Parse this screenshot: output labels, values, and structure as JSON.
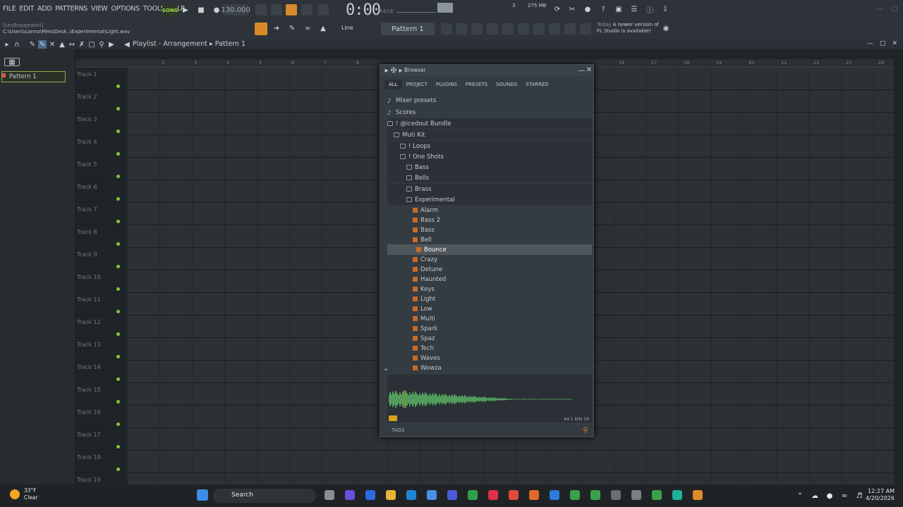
{
  "menu": [
    "FILE",
    "EDIT",
    "ADD",
    "PATTERNS",
    "VIEW",
    "OPTIONS",
    "TOOLS",
    "HELP"
  ],
  "hint_user": "[LeoBogajewski]",
  "hint_path": "C:\\Users\\canno\\Files\\Desk..\\Experimental\\Light.wav",
  "transport": {
    "song_label": "SONG",
    "tempo": "130.000",
    "time": "0:00",
    "time_sub": "M:S:CS",
    "pattern": "Pattern 1",
    "snap": "Line",
    "mem": "275 MB",
    "cpu": "3"
  },
  "news": {
    "day": "Today",
    "text1": "A newer version of",
    "text2": "FL Studio is available!"
  },
  "playlist": {
    "title": "Playlist - Arrangement",
    "pattern": "Pattern 1",
    "pattern_item": "Pattern 1"
  },
  "tracks": [
    "Track 1",
    "Track 2",
    "Track 3",
    "Track 4",
    "Track 5",
    "Track 6",
    "Track 7",
    "Track 8",
    "Track 9",
    "Track 10",
    "Track 11",
    "Track 12",
    "Track 13",
    "Track 14",
    "Track 15",
    "Track 16",
    "Track 17",
    "Track 18",
    "Track 19"
  ],
  "ruler": [
    "2",
    "3",
    "4",
    "5",
    "6",
    "7",
    "8",
    "16",
    "17",
    "18",
    "19",
    "20",
    "21",
    "22",
    "23",
    "24"
  ],
  "browser": {
    "title": "Browser",
    "tabs": [
      "ALL",
      "PROJECT",
      "PLUGINS",
      "PRESETS",
      "SOUNDS",
      "STARRED"
    ],
    "items": [
      {
        "label": "Mixer presets",
        "indent": 0,
        "type": "special"
      },
      {
        "label": "Scores",
        "indent": 0,
        "type": "special"
      },
      {
        "label": "! @icedout Bundle",
        "indent": 0,
        "type": "folder",
        "dark": true
      },
      {
        "label": "Muti Kit",
        "indent": 1,
        "type": "folder",
        "dark": true
      },
      {
        "label": "! Loops",
        "indent": 2,
        "type": "folder",
        "dark": true
      },
      {
        "label": "! One Shots",
        "indent": 2,
        "type": "folder",
        "dark": true
      },
      {
        "label": "Bass",
        "indent": 3,
        "type": "folder",
        "dark": true
      },
      {
        "label": "Bells",
        "indent": 3,
        "type": "folder",
        "dark": true
      },
      {
        "label": "Brass",
        "indent": 3,
        "type": "folder",
        "dark": true
      },
      {
        "label": "Experimental",
        "indent": 3,
        "type": "folder",
        "dark": true
      },
      {
        "label": "Alarm",
        "indent": 4,
        "type": "file"
      },
      {
        "label": "Bass 2",
        "indent": 4,
        "type": "file"
      },
      {
        "label": "Bass",
        "indent": 4,
        "type": "file"
      },
      {
        "label": "Bell",
        "indent": 4,
        "type": "file"
      },
      {
        "label": "Bounce",
        "indent": 4,
        "type": "file",
        "selected": true
      },
      {
        "label": "Crazy",
        "indent": 4,
        "type": "file"
      },
      {
        "label": "Detune",
        "indent": 4,
        "type": "file"
      },
      {
        "label": "Haunted",
        "indent": 4,
        "type": "file"
      },
      {
        "label": "Keys",
        "indent": 4,
        "type": "file"
      },
      {
        "label": "Light",
        "indent": 4,
        "type": "file"
      },
      {
        "label": "Low",
        "indent": 4,
        "type": "file"
      },
      {
        "label": "Multi",
        "indent": 4,
        "type": "file"
      },
      {
        "label": "Spark",
        "indent": 4,
        "type": "file"
      },
      {
        "label": "Spaz",
        "indent": 4,
        "type": "file"
      },
      {
        "label": "Tech",
        "indent": 4,
        "type": "file"
      },
      {
        "label": "Waves",
        "indent": 4,
        "type": "file"
      },
      {
        "label": "Wowza",
        "indent": 4,
        "type": "file"
      }
    ],
    "wave_info": "44.1 kHz 16",
    "tags": "TAGS"
  },
  "taskbar": {
    "temp": "33°F",
    "cond": "Clear",
    "search": "Search",
    "time": "12:27 AM",
    "date": "4/20/2026"
  },
  "colors": {
    "accent": "#7ec73c",
    "wave": "#5fbf6a",
    "file": "#c86a2a"
  }
}
